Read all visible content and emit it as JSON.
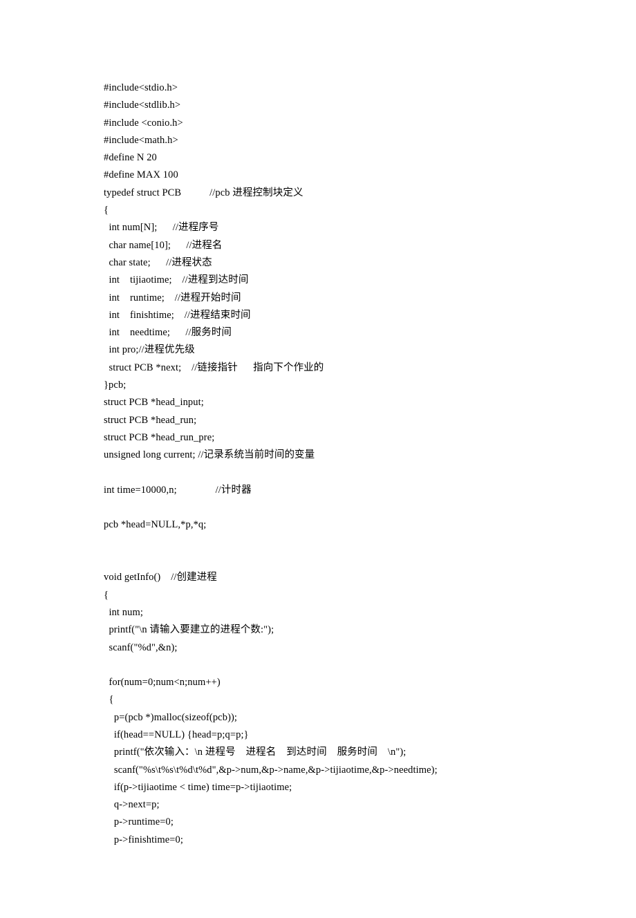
{
  "lines": [
    "#include<stdio.h>",
    "#include<stdlib.h>",
    "#include <conio.h>",
    "#include<math.h>",
    "#define N 20",
    "#define MAX 100",
    "typedef struct PCB           //pcb 进程控制块定义",
    "{",
    "  int num[N];      //进程序号",
    "  char name[10];      //进程名",
    "  char state;      //进程状态",
    "  int    tijiaotime;    //进程到达时间",
    "  int    runtime;    //进程开始时间",
    "  int    finishtime;    //进程结束时间",
    "  int    needtime;      //服务时间",
    "  int pro;//进程优先级",
    "  struct PCB *next;    //链接指针      指向下个作业的",
    "}pcb;",
    "struct PCB *head_input;",
    "struct PCB *head_run;",
    "struct PCB *head_run_pre;",
    "unsigned long current; //记录系统当前时间的变量",
    "",
    "int time=10000,n;               //计时器",
    "",
    "pcb *head=NULL,*p,*q;",
    "",
    "",
    "void getInfo()    //创建进程",
    "{",
    "  int num;",
    "  printf(\"\\n 请输入要建立的进程个数:\");",
    "  scanf(\"%d\",&n);",
    "",
    "  for(num=0;num<n;num++)",
    "  {",
    "    p=(pcb *)malloc(sizeof(pcb));",
    "    if(head==NULL) {head=p;q=p;}",
    "    printf(\"依次输入：\\n 进程号    进程名    到达时间    服务时间    \\n\");",
    "    scanf(\"%s\\t%s\\t%d\\t%d\",&p->num,&p->name,&p->tijiaotime,&p->needtime);",
    "    if(p->tijiaotime < time) time=p->tijiaotime;",
    "    q->next=p;",
    "    p->runtime=0;",
    "    p->finishtime=0;"
  ]
}
